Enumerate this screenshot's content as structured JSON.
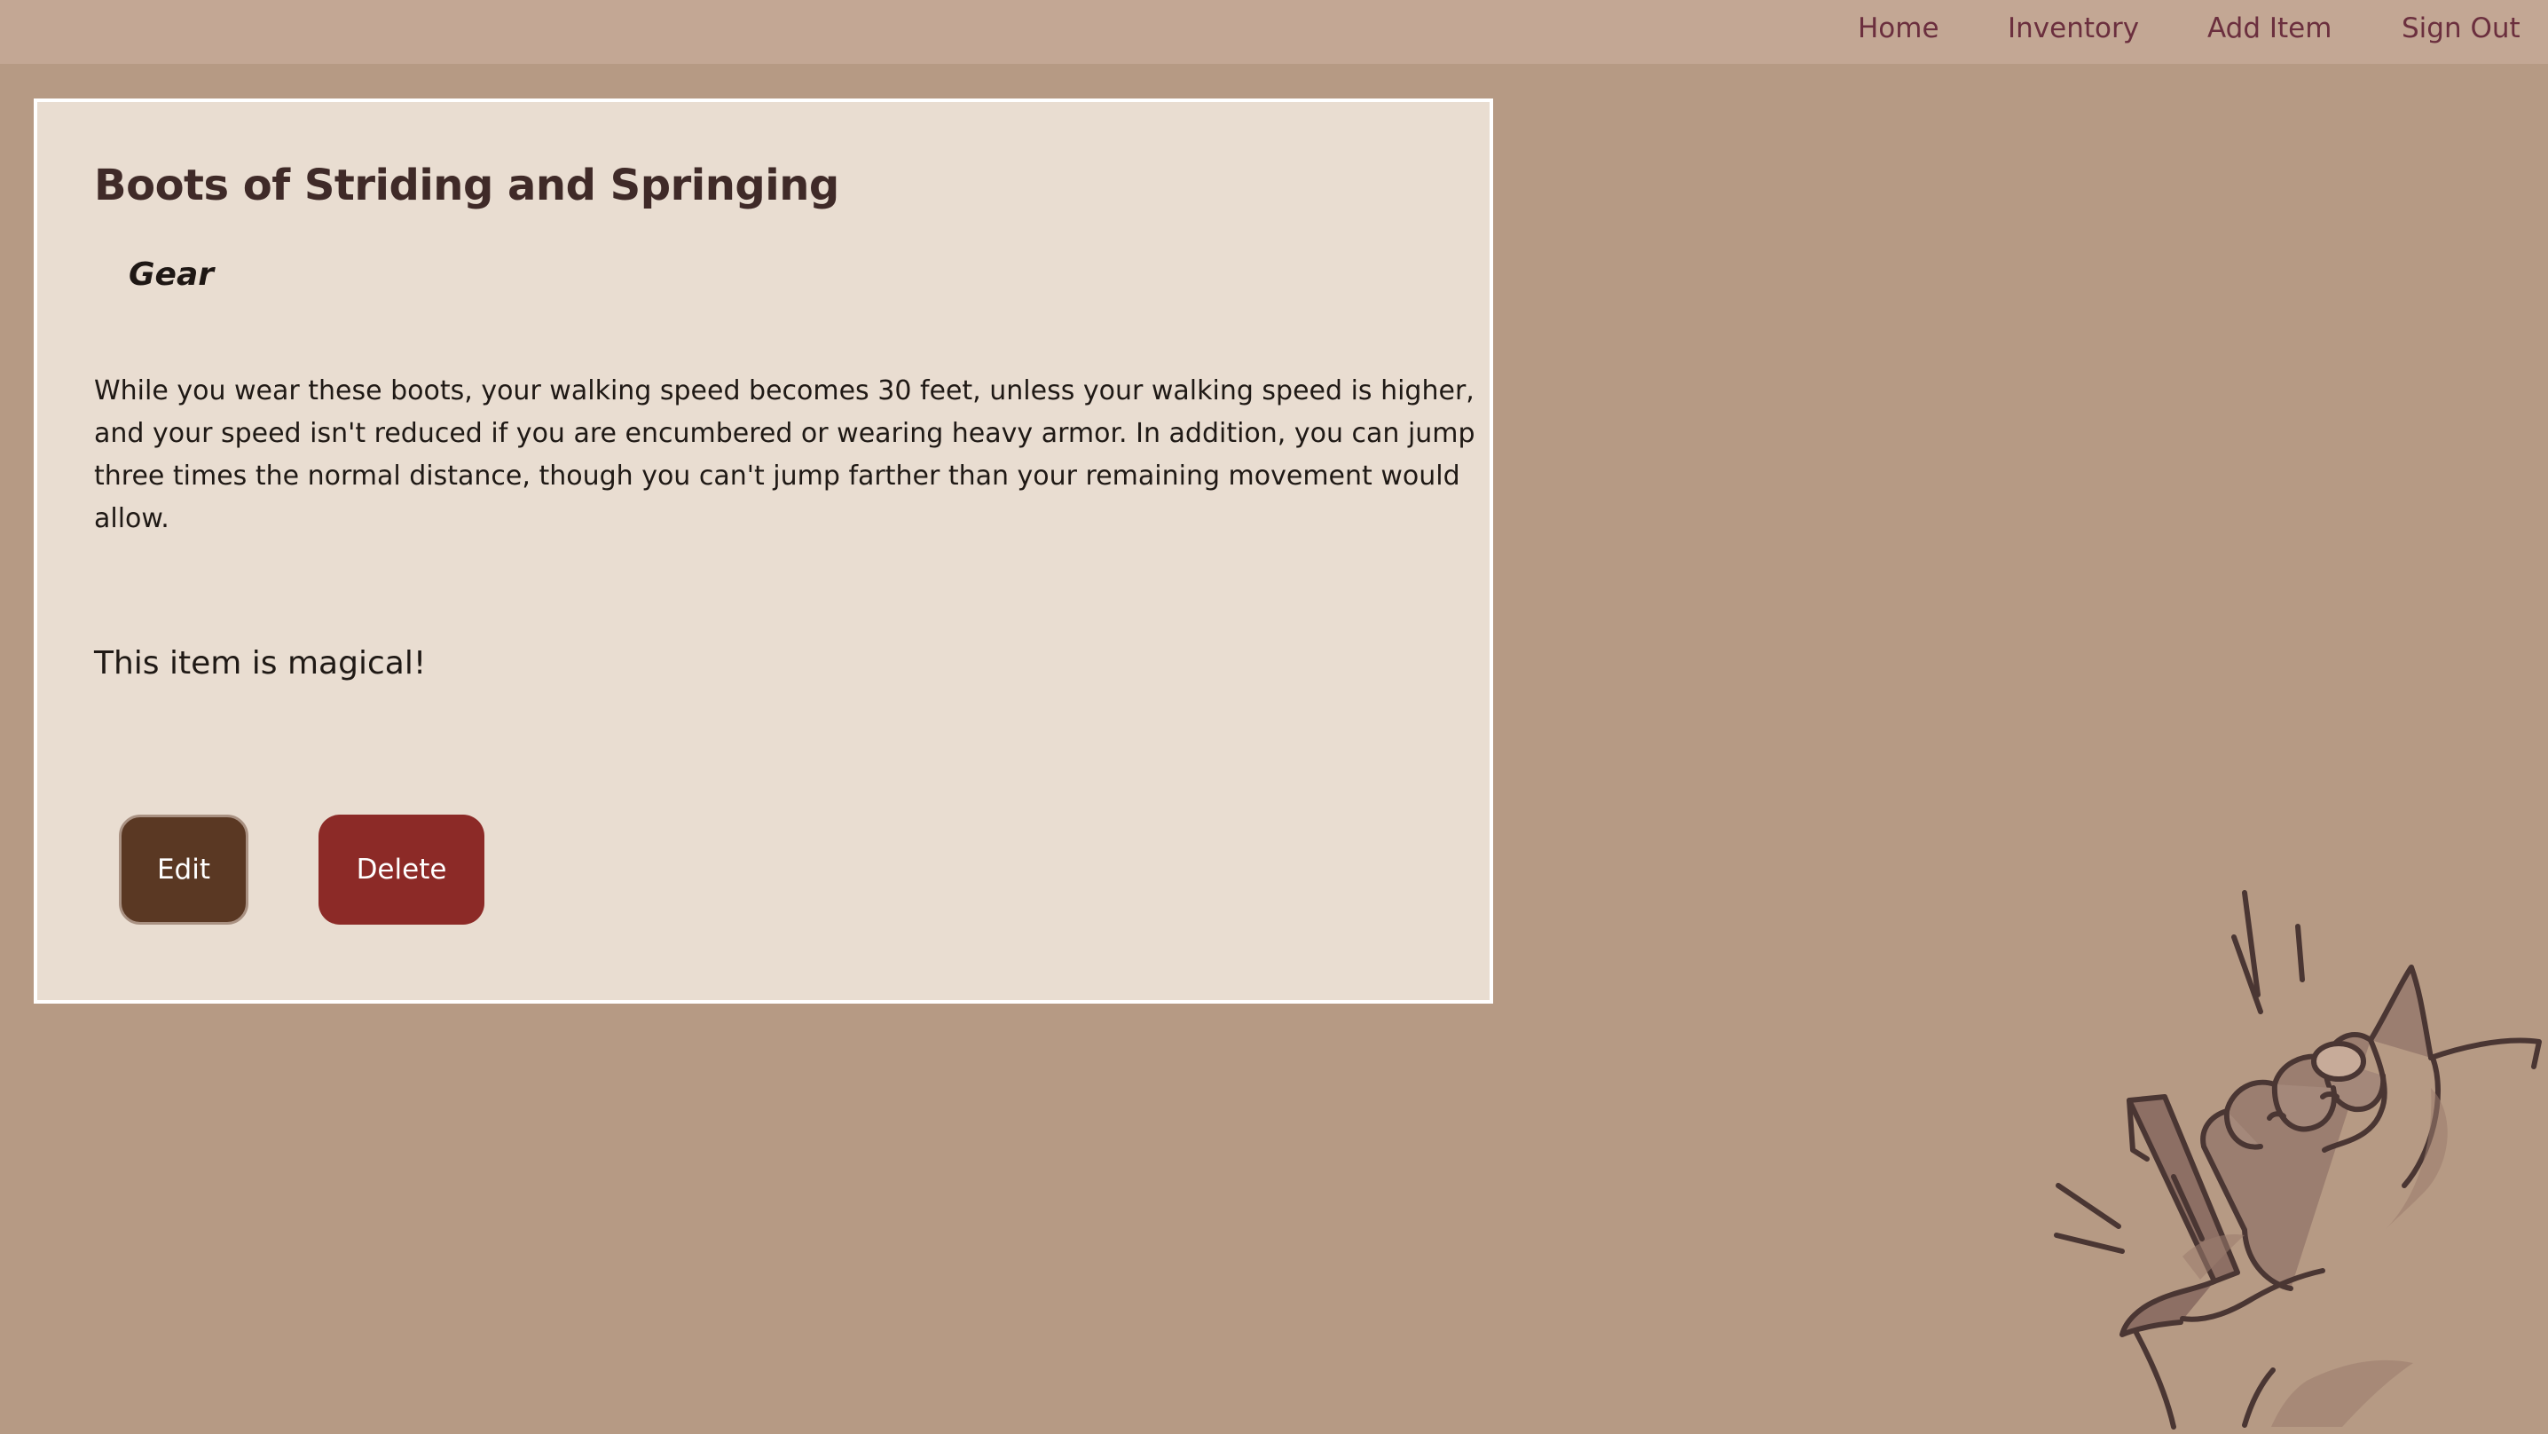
{
  "nav": {
    "home": "Home",
    "inventory": "Inventory",
    "add_item": "Add Item",
    "sign_out": "Sign Out"
  },
  "item": {
    "name": "Boots of Striding and Springing",
    "category": "Gear",
    "description": "While you wear these boots, your walking speed becomes 30 feet, unless your walking speed is higher, and your speed isn't reduced if you are encumbered or wearing heavy armor. In addition, you can jump three times the normal distance, though you can't jump farther than your remaining movement would allow.",
    "magic_note": "This item is magical!"
  },
  "actions": {
    "edit_label": "Edit",
    "delete_label": "Delete"
  },
  "colors": {
    "background": "#b69a84",
    "nav_bar": "#c3a794",
    "nav_link": "#6b2f3e",
    "card": "#e9ddd1",
    "edit_button": "#5a3823",
    "delete_button": "#8c2a27"
  },
  "decoration": {
    "icon": "gnome-hand-holding-torch-illustration"
  }
}
